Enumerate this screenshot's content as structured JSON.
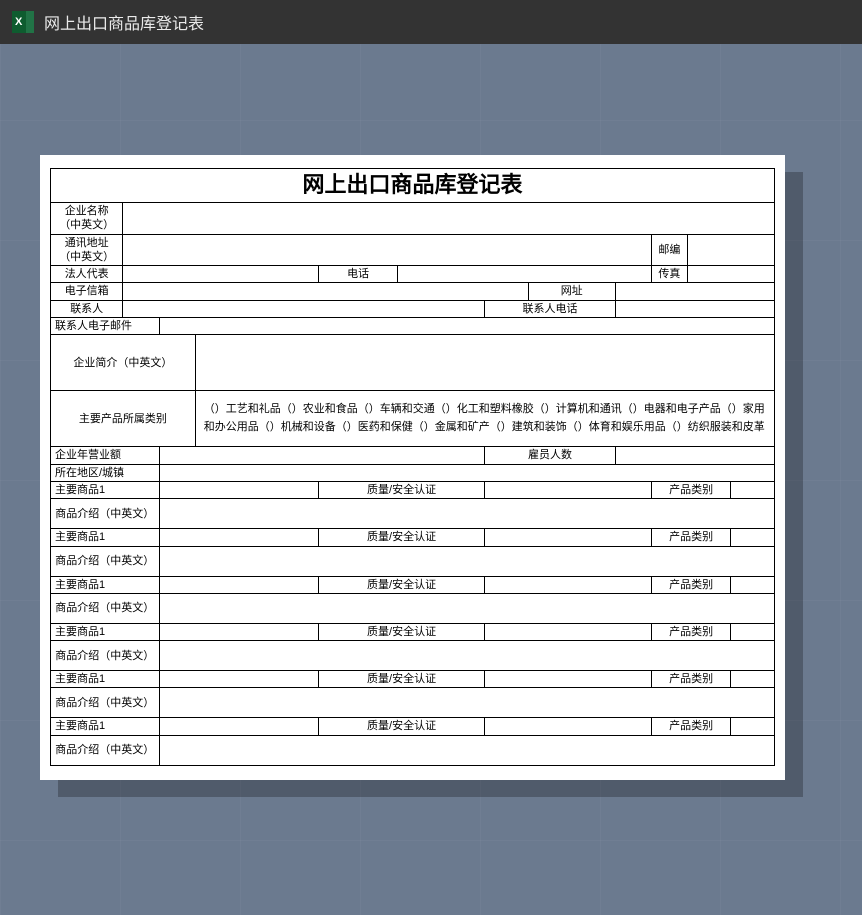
{
  "header": {
    "title": "网上出口商品库登记表"
  },
  "form": {
    "title": "网上出口商品库登记表",
    "labels": {
      "company_name": "企业名称（中英文）",
      "address": "通讯地址（中英文）",
      "postcode": "邮编",
      "legal_rep": "法人代表",
      "phone": "电话",
      "fax": "传真",
      "email": "电子信箱",
      "website": "网址",
      "contact": "联系人",
      "contact_phone": "联系人电话",
      "contact_email": "联系人电子邮件",
      "company_profile": "企业简介（中英文）",
      "product_category_label": "主要产品所属类别",
      "product_categories_text": "（）工艺和礼品（）农业和食品（）车辆和交通（）化工和塑料橡胶（）计算机和通讯（）电器和电子产品（）家用和办公用品（）机械和设备（）医药和保健（）金属和矿产（）建筑和装饰（）体育和娱乐用品（）纺织服装和皮革",
      "annual_revenue": "企业年营业额",
      "employees": "雇员人数",
      "region": "所在地区/城镇",
      "main_product": "主要商品1",
      "quality_cert": "质量/安全认证",
      "prod_category": "产品类别",
      "product_intro": "商品介绍（中英文）"
    }
  }
}
